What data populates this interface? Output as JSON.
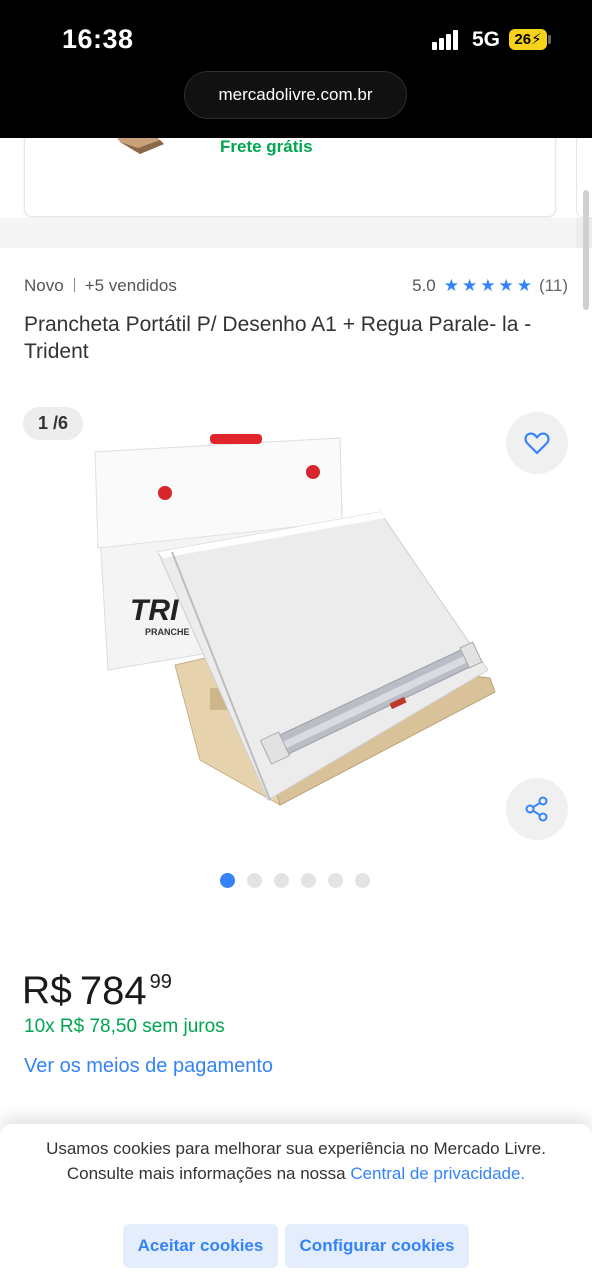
{
  "status_bar": {
    "time": "16:38",
    "network": "5G",
    "battery": "26"
  },
  "browser": {
    "url": "mercadolivre.com.br"
  },
  "previous_card": {
    "shipping": "Frete grátis"
  },
  "product": {
    "condition": "Novo",
    "sold": "+5 vendidos",
    "rating_value": "5.0",
    "rating_stars": 5,
    "reviews": "(11)",
    "title": "Prancheta Portátil P/ Desenho A1 + Regua Parale- la - Trident"
  },
  "gallery": {
    "counter": "1 /6",
    "total": 6,
    "active_index": 0,
    "image_brand": "TRI",
    "image_sub": "PRANCHE"
  },
  "icons": {
    "favorite": "heart-icon",
    "share": "share-icon",
    "rating": "star-icon"
  },
  "price": {
    "currency": "R$",
    "integer": "784",
    "cents": "99",
    "installments": "10x R$ 78,50 sem juros",
    "payment_link": "Ver os meios de pagamento"
  },
  "cookie_banner": {
    "text": "Usamos cookies para melhorar sua experiência no Mercado Livre. Consulte mais informações na nossa ",
    "link": "Central de privacidade.",
    "accept": "Aceitar cookies",
    "configure": "Configurar cookies"
  },
  "colors": {
    "accent": "#3483fa",
    "green": "#00a650",
    "text": "#333333",
    "battery": "#f7d21a"
  }
}
